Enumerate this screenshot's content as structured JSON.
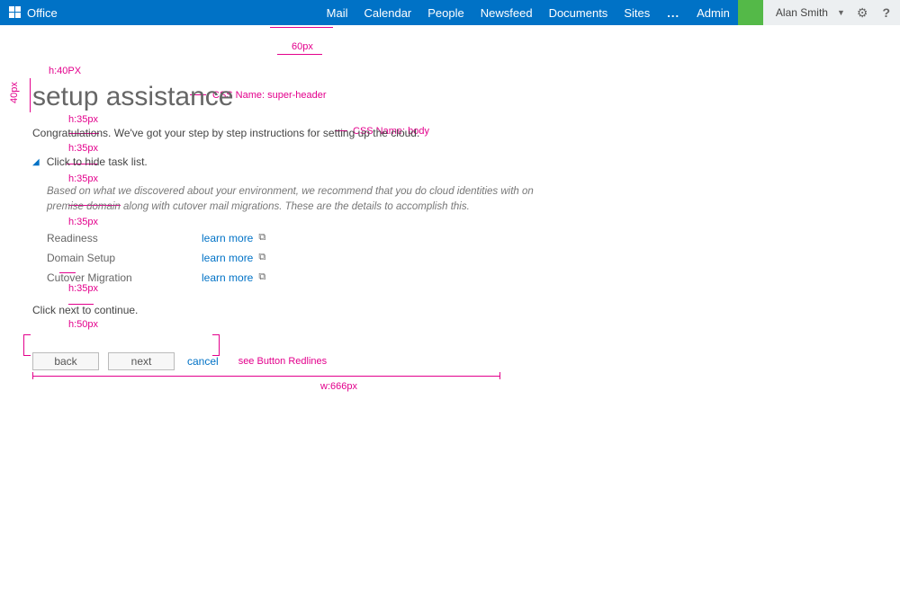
{
  "topbar": {
    "brand": "Office",
    "nav": [
      "Mail",
      "Calendar",
      "People",
      "Newsfeed",
      "Documents",
      "Sites"
    ],
    "ellipsis": "...",
    "admin": "Admin"
  },
  "userbar": {
    "name": "Alan Smith"
  },
  "content": {
    "title": "setup assistance",
    "intro": "Congratulations. We've got your step by step instructions for setting up the cloud.",
    "toggle_label": "Click to hide task list.",
    "description": "Based on what we discovered about your environment, we recommend that you do cloud identities with on premise domain along with cutover mail migrations. These are the details to  accomplish this.",
    "tasks": [
      {
        "name": "Readiness",
        "link": "learn more"
      },
      {
        "name": "Domain Setup",
        "link": "learn more"
      },
      {
        "name": "Cutover Migration",
        "link": "learn more"
      }
    ],
    "continue_text": "Click next to continue.",
    "buttons": {
      "back": "back",
      "next": "next",
      "cancel": "cancel"
    }
  },
  "redlines": {
    "h40": "h:40PX",
    "left40": "40px",
    "top60": "60px",
    "css_super": "CSS Name:  super-header",
    "css_body": "CSS Name: body",
    "h35_1": "h:35px",
    "h35_2": "h:35px",
    "h35_3": "h:35px",
    "h35_4": "h:35px",
    "h35_5": "h:35px",
    "h50": "h:50px",
    "button_note": "see Button Redlines",
    "w666": "w:666px"
  }
}
